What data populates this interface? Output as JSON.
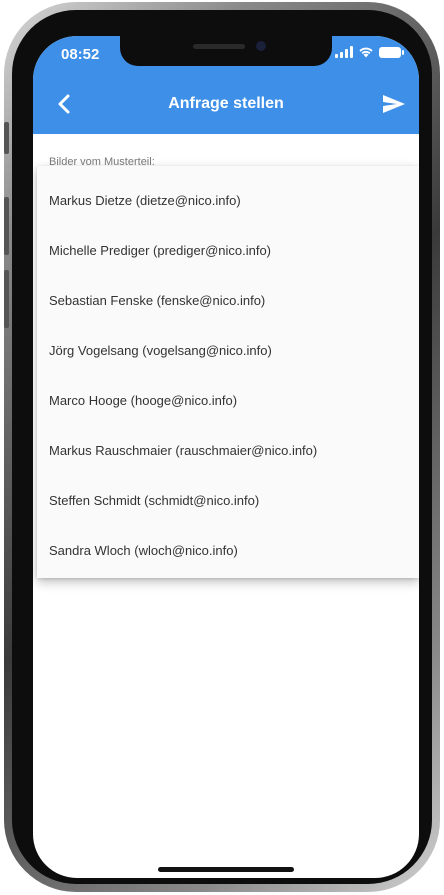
{
  "status_bar": {
    "time": "08:52"
  },
  "app_bar": {
    "title": "Anfrage stellen"
  },
  "form": {
    "field_label": "Bilder vom Musterteil:"
  },
  "dropdown": {
    "options": [
      "Markus Dietze (dietze@nico.info)",
      "Michelle Prediger (prediger@nico.info)",
      "Sebastian Fenske (fenske@nico.info)",
      "Jörg Vogelsang (vogelsang@nico.info)",
      "Marco Hooge (hooge@nico.info)",
      "Markus Rauschmaier (rauschmaier@nico.info)",
      "Steffen Schmidt (schmidt@nico.info)",
      "Sandra Wloch (wloch@nico.info)"
    ]
  },
  "colors": {
    "accent": "#3d8fe8",
    "menu_background": "#fafafa",
    "text": "#333333"
  }
}
